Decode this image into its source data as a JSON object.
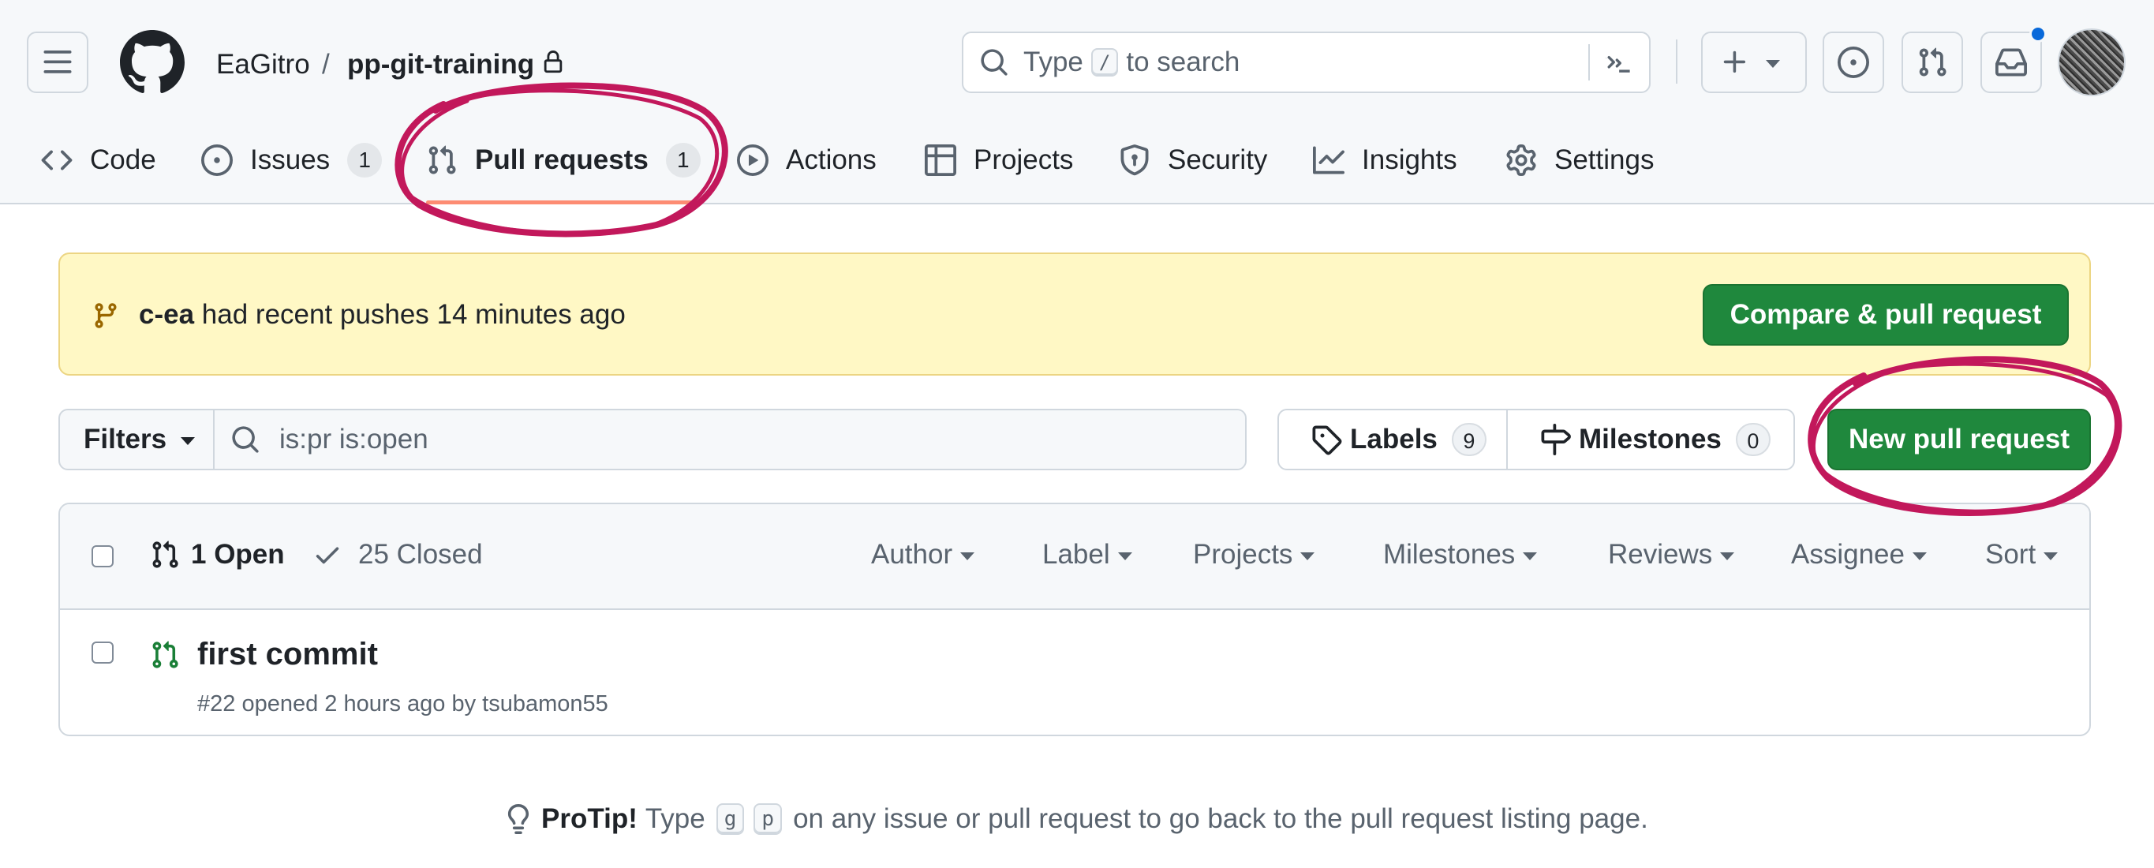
{
  "header": {
    "owner": "EaGitro",
    "separator": "/",
    "repo": "pp-git-training",
    "search_prefix": "Type",
    "search_key": "/",
    "search_suffix": "to search"
  },
  "tabs": [
    {
      "label": "Code",
      "icon": "code-icon"
    },
    {
      "label": "Issues",
      "count": "1",
      "icon": "issue-opened-icon"
    },
    {
      "label": "Pull requests",
      "count": "1",
      "icon": "git-pull-request-icon"
    },
    {
      "label": "Actions",
      "icon": "play-icon"
    },
    {
      "label": "Projects",
      "icon": "table-icon"
    },
    {
      "label": "Security",
      "icon": "shield-icon"
    },
    {
      "label": "Insights",
      "icon": "graph-icon"
    },
    {
      "label": "Settings",
      "icon": "gear-icon"
    }
  ],
  "banner": {
    "branch": "c-ea",
    "text": "had recent pushes 14 minutes ago",
    "button": "Compare & pull request"
  },
  "filters": {
    "button": "Filters",
    "search_value": "is:pr is:open",
    "labels": "Labels",
    "labels_count": "9",
    "milestones": "Milestones",
    "milestones_count": "0",
    "new_pr": "New pull request"
  },
  "list": {
    "open": "1 Open",
    "closed": "25 Closed",
    "sort_menus": [
      "Author",
      "Label",
      "Projects",
      "Milestones",
      "Reviews",
      "Assignee",
      "Sort"
    ],
    "items": [
      {
        "title": "first commit",
        "meta": "#22 opened 2 hours ago by tsubamon55"
      }
    ]
  },
  "protip": {
    "bold": "ProTip!",
    "prefix": "Type",
    "key1": "g",
    "key2": "p",
    "suffix": "on any issue or pull request to go back to the pull request listing page."
  },
  "colors": {
    "accent_green": "#1f883d",
    "annotation_circle": "#c2185b",
    "banner_bg": "#fff8c5",
    "underline": "#fd8c73",
    "notification_dot": "#0969da"
  }
}
